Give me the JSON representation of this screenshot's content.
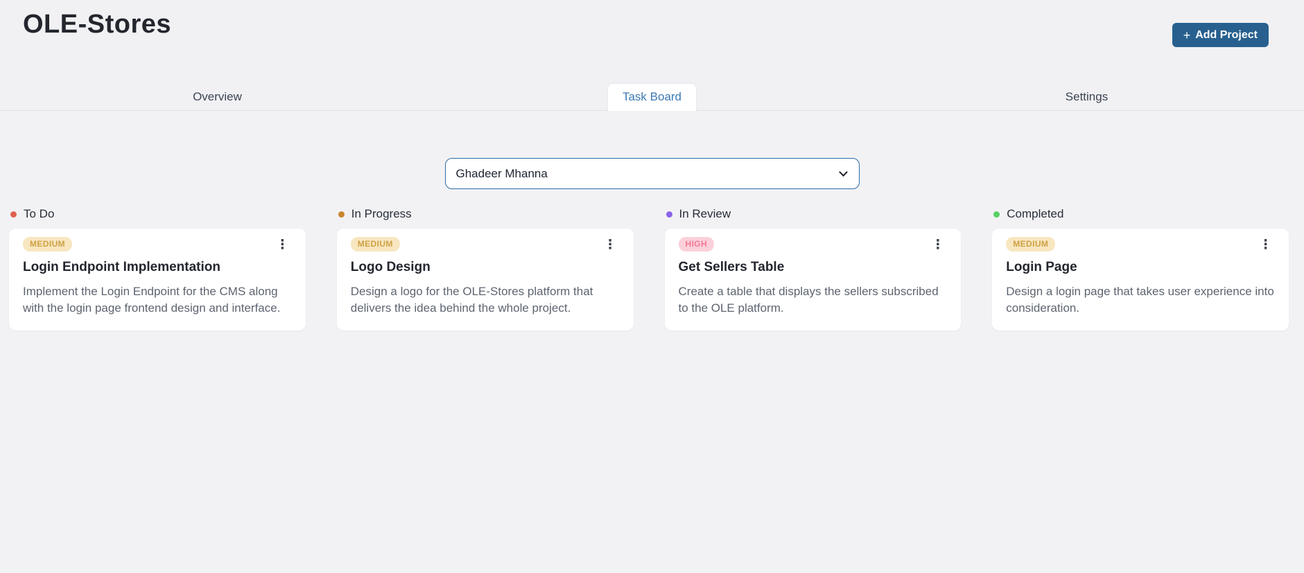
{
  "header": {
    "title": "OLE-Stores",
    "add_project": {
      "icon": "+",
      "label": "Add Project"
    }
  },
  "tabs": [
    {
      "label": "Overview",
      "active": false
    },
    {
      "label": "Task Board",
      "active": true
    },
    {
      "label": "Settings",
      "active": false
    }
  ],
  "filter": {
    "selected_member": "Ghadeer Mhanna"
  },
  "board": {
    "columns": [
      {
        "name": "To Do",
        "dot_color": "#e0614f",
        "cards": [
          {
            "priority": "MEDIUM",
            "title": "Login Endpoint Implementation",
            "description": "Implement the Login Endpoint for the CMS along with the login page frontend design and interface."
          }
        ]
      },
      {
        "name": "In Progress",
        "dot_color": "#c8872e",
        "cards": [
          {
            "priority": "MEDIUM",
            "title": "Logo Design",
            "description": "Design a logo for the OLE-Stores platform that delivers the idea behind the whole project."
          }
        ]
      },
      {
        "name": "In Review",
        "dot_color": "#8a63e8",
        "cards": [
          {
            "priority": "HIGH",
            "title": "Get Sellers Table",
            "description": "Create a table that displays the sellers subscribed to the OLE platform."
          }
        ]
      },
      {
        "name": "Completed",
        "dot_color": "#57d163",
        "cards": [
          {
            "priority": "MEDIUM",
            "title": "Login Page",
            "description": "Design a login page that takes user experience into consideration."
          }
        ]
      }
    ]
  },
  "icons": {
    "plus": "+",
    "kebab_menu": "⋮"
  },
  "colors": {
    "page_background": "#f2f2f5",
    "accent_blue": "#27608f",
    "active_tab_text": "#3b78b6",
    "select_border": "#2d6da6",
    "badge_medium_bg": "#f8e6c0",
    "badge_medium_text": "#cfa144",
    "badge_high_bg": "#fbd0da",
    "badge_high_text": "#ee7b94"
  }
}
